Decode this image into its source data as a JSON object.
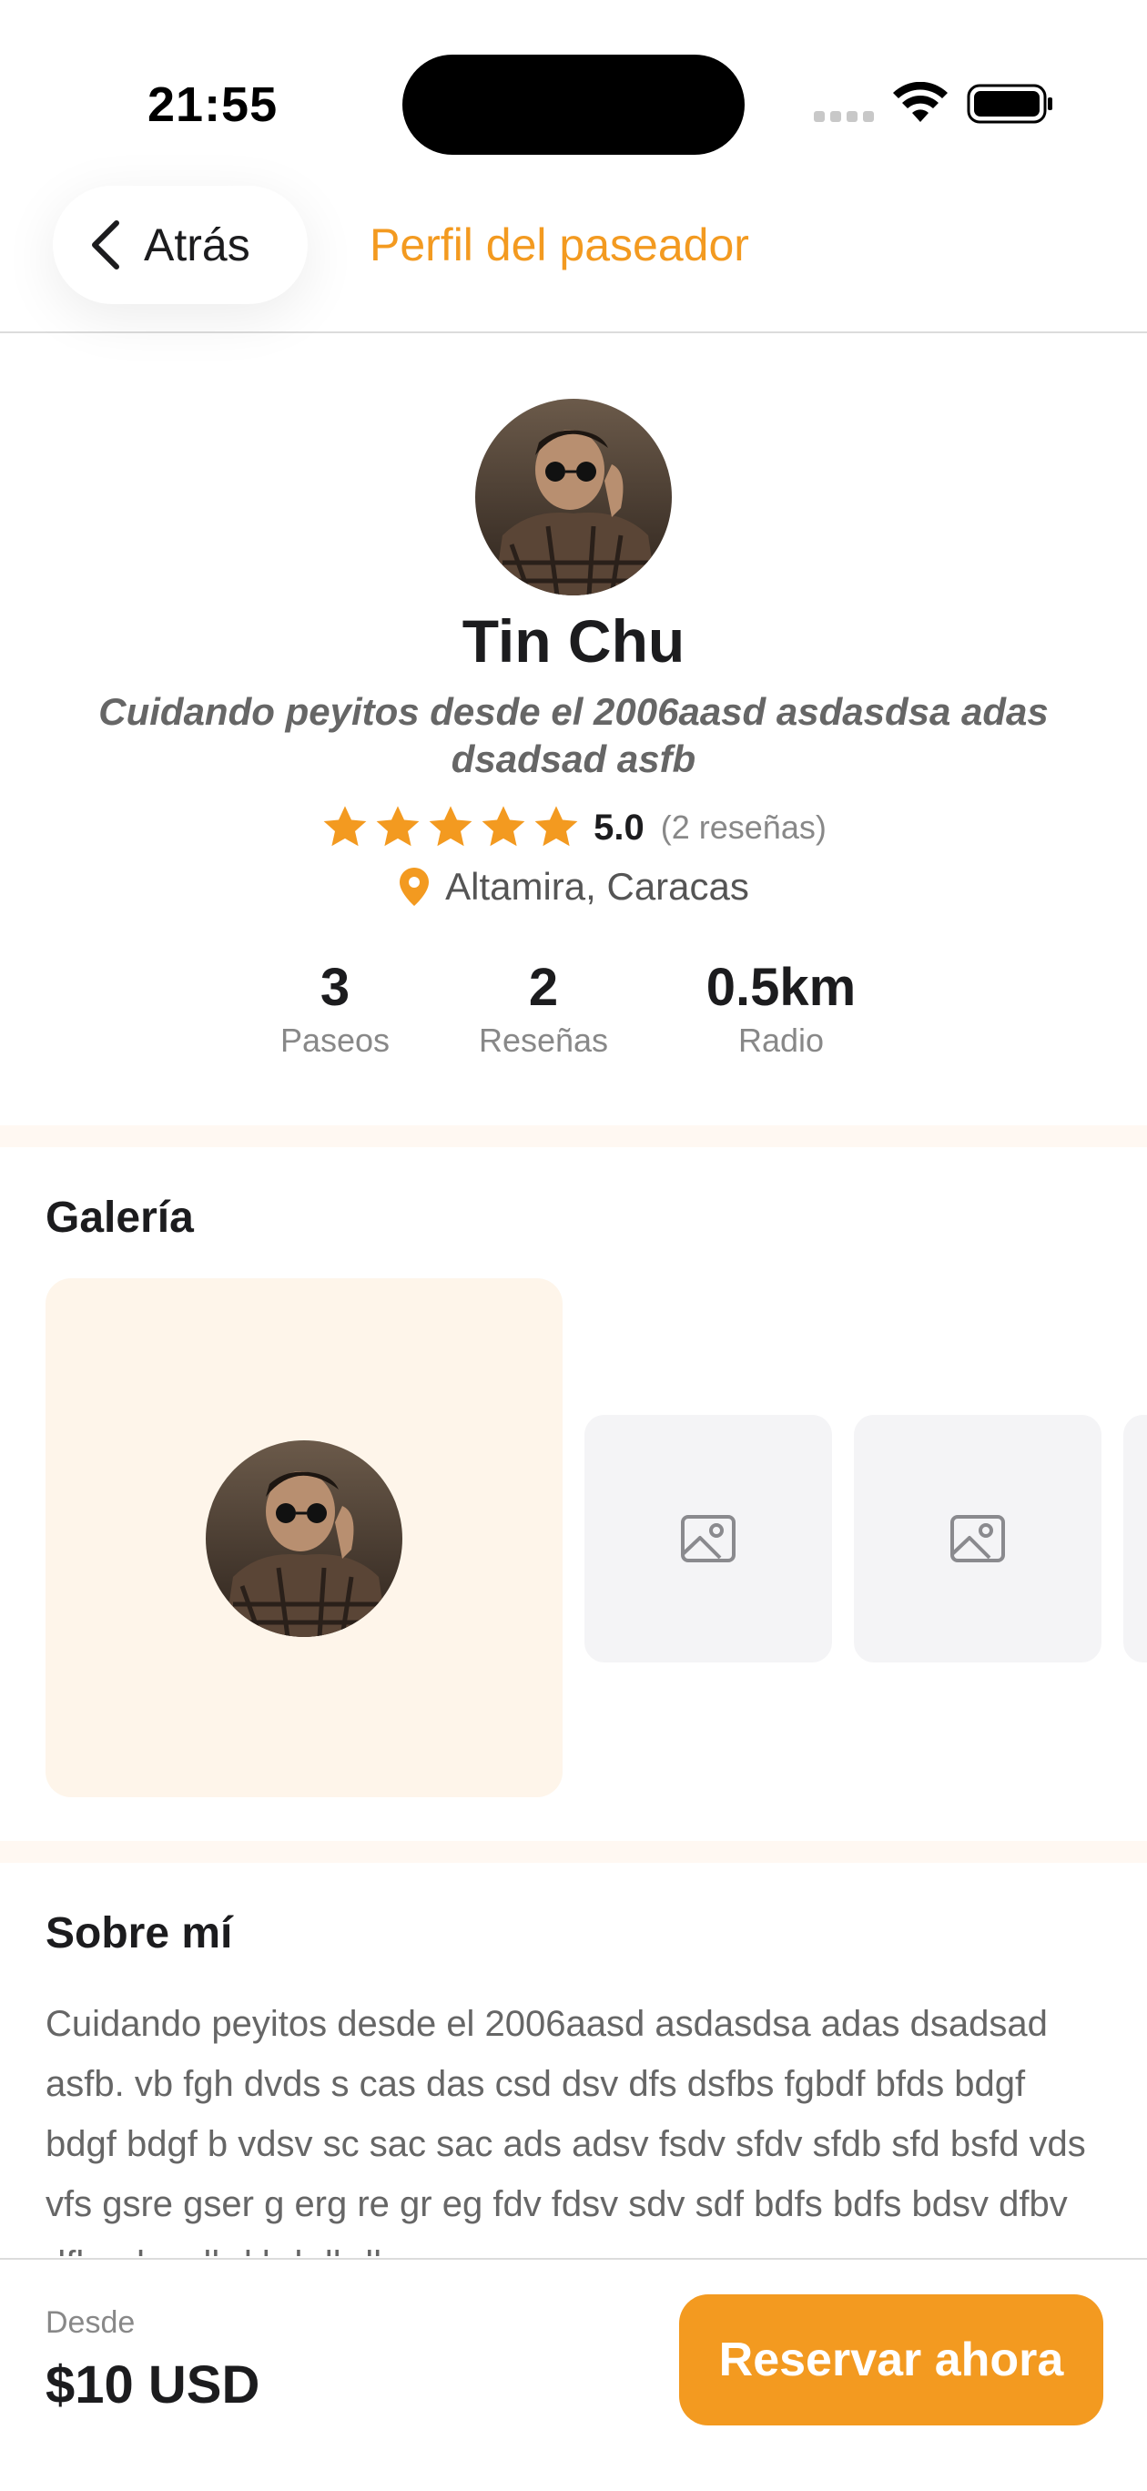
{
  "status_bar": {
    "time": "21:55",
    "icons": [
      "cellular-signal-icon",
      "wifi-icon",
      "battery-icon"
    ]
  },
  "header": {
    "back_label": "Atrás",
    "title": "Perfil del paseador",
    "back_icon": "chevron-left-icon"
  },
  "profile": {
    "name": "Tin Chu",
    "tagline": "Cuidando peyitos desde el 2006aasd asdasdsa adas dsadsad asfb",
    "rating_value": "5.0",
    "rating_count": "(2 reseñas)",
    "stars": 5,
    "location": "Altamira, Caracas",
    "location_icon": "map-pin-icon"
  },
  "stats": [
    {
      "value": "3",
      "label": "Paseos"
    },
    {
      "value": "2",
      "label": "Reseñas"
    },
    {
      "value": "0.5km",
      "label": "Radio"
    }
  ],
  "gallery": {
    "title": "Galería",
    "thumbs": [
      "image-placeholder-icon",
      "image-placeholder-icon",
      "image-placeholder-icon"
    ]
  },
  "about": {
    "title": "Sobre mí",
    "text": "Cuidando peyitos desde el 2006aasd asdasdsa adas dsadsad asfb. vb fgh dvds s cas das csd dsv dfs dsfbs fgbdf bfds bdgf bdgf bdgf b vdsv sc sac sac ads adsv fsdv sfdv sfdb sfd bsfd vds vfs gsre gser g erg re gr eg fdv fdsv sdv sdf bdfs bdfs bdsv dfbv dfbs dsv dbd bd dbdb"
  },
  "footer": {
    "price_label": "Desde",
    "price_value": "$10 USD",
    "book_label": "Reservar ahora"
  },
  "colors": {
    "accent": "#f39a20",
    "text_primary": "#1c1c1e",
    "text_secondary": "#888888",
    "gallery_bg": "#fef5ea",
    "thumb_bg": "#f4f4f6"
  }
}
